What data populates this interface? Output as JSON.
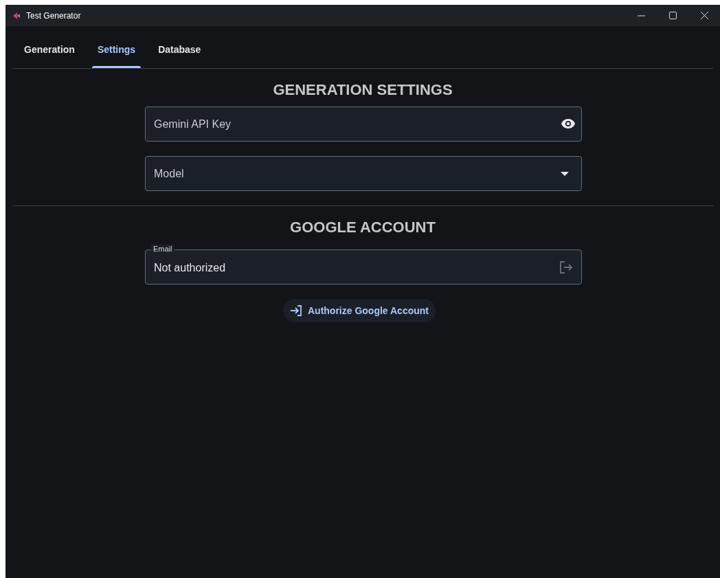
{
  "window": {
    "title": "Test Generator"
  },
  "tabs": [
    {
      "label": "Generation",
      "selected": false
    },
    {
      "label": "Settings",
      "selected": true
    },
    {
      "label": "Database",
      "selected": false
    }
  ],
  "generation_settings": {
    "heading": "GENERATION SETTINGS",
    "api_key": {
      "placeholder": "Gemini API Key"
    },
    "model": {
      "placeholder": "Model"
    }
  },
  "google_account": {
    "heading": "GOOGLE ACCOUNT",
    "email": {
      "label": "Email",
      "value": "Not authorized"
    },
    "authorize_button": "Authorize Google Account"
  }
}
